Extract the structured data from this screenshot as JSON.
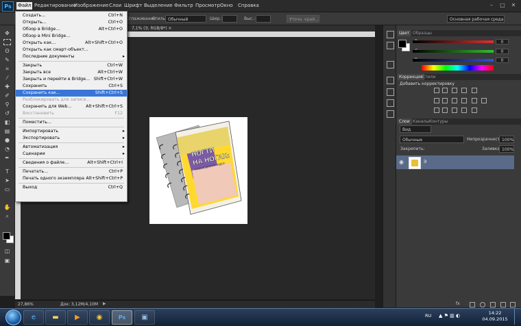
{
  "app": {
    "logo": "Ps",
    "menus": [
      "Файл",
      "Редактирование",
      "Изображение",
      "Слои",
      "Шрифт",
      "Выделение",
      "Фильтр",
      "Просмотр",
      "Окно",
      "Справка"
    ],
    "active_menu": "Файл",
    "window_controls": [
      "–",
      "□",
      "✕"
    ]
  },
  "options_bar": {
    "style_label": "Стиль:",
    "style_value": "Обычный",
    "width_label": "Шир.:",
    "height_label": "Выс.:",
    "refine_button": "Уточн. край...",
    "workspace": "Основная рабочая среда",
    "smoothing_label": "Сглаживание"
  },
  "document": {
    "tab_title": "7,1% (Э, RGB/8*) ×",
    "zoom": "27,86%",
    "doc_size": "Док: 3,12M/4,10M"
  },
  "file_menu": {
    "items": [
      {
        "label": "Создать...",
        "shortcut": "Ctrl+N"
      },
      {
        "label": "Открыть...",
        "shortcut": "Ctrl+O"
      },
      {
        "label": "Обзор в Bridge...",
        "shortcut": "Alt+Ctrl+O"
      },
      {
        "label": "Обзор в Mini Bridge...",
        "shortcut": ""
      },
      {
        "label": "Открыть как...",
        "shortcut": "Alt+Shift+Ctrl+O"
      },
      {
        "label": "Открыть как смарт-объект...",
        "shortcut": ""
      },
      {
        "label": "Последние документы",
        "shortcut": "",
        "submenu": true
      },
      {
        "sep": true
      },
      {
        "label": "Закрыть",
        "shortcut": "Ctrl+W"
      },
      {
        "label": "Закрыть все",
        "shortcut": "Alt+Ctrl+W"
      },
      {
        "label": "Закрыть и перейти в Bridge...",
        "shortcut": "Shift+Ctrl+W"
      },
      {
        "label": "Сохранить",
        "shortcut": "Ctrl+S"
      },
      {
        "label": "Сохранить как...",
        "shortcut": "Shift+Ctrl+S",
        "highlight": true
      },
      {
        "label": "Разблокировать для записи...",
        "shortcut": "",
        "disabled": true
      },
      {
        "label": "Сохранить для Web...",
        "shortcut": "Alt+Shift+Ctrl+S"
      },
      {
        "label": "Восстановить",
        "shortcut": "F12",
        "disabled": true
      },
      {
        "sep": true
      },
      {
        "label": "Поместить...",
        "shortcut": ""
      },
      {
        "sep": true
      },
      {
        "label": "Импортировать",
        "shortcut": "",
        "submenu": true
      },
      {
        "label": "Экспортировать",
        "shortcut": "",
        "submenu": true
      },
      {
        "sep": true
      },
      {
        "label": "Автоматизация",
        "shortcut": "",
        "submenu": true
      },
      {
        "label": "Сценарии",
        "shortcut": "",
        "submenu": true
      },
      {
        "sep": true
      },
      {
        "label": "Сведения о файле...",
        "shortcut": "Alt+Shift+Ctrl+I"
      },
      {
        "sep": true
      },
      {
        "label": "Печатать...",
        "shortcut": "Ctrl+P"
      },
      {
        "label": "Печать одного экземпляра",
        "shortcut": "Alt+Shift+Ctrl+P"
      },
      {
        "sep": true
      },
      {
        "label": "Выход",
        "shortcut": "Ctrl+Q"
      }
    ]
  },
  "color_panel": {
    "tabs": [
      "Цвет",
      "Образцы"
    ],
    "channels": [
      {
        "label": "R",
        "value": "0",
        "color": "#e03030"
      },
      {
        "label": "G",
        "value": "0",
        "color": "#30c030"
      },
      {
        "label": "B",
        "value": "0",
        "color": "#3050e0"
      }
    ]
  },
  "adjustments_panel": {
    "tabs": [
      "Коррекция",
      "Стили"
    ],
    "heading": "Добавить корректировку"
  },
  "layers_panel": {
    "tabs": [
      "Слои",
      "Каналы",
      "Контуры"
    ],
    "kind_label": "Вид",
    "blend_mode": "Обычные",
    "opacity_label": "Непрозрачность:",
    "opacity_value": "100%",
    "lock_label": "Закрепить:",
    "fill_label": "Заливка:",
    "fill_value": "100%",
    "layer_name": "Э",
    "footer_icons": "fx"
  },
  "book": {
    "title_line1": "НОГТИ",
    "title_line2": "НА НОГАХ:",
    "subtitle": "НОВЫЕ ДИЗАЙН-ИДЕИ"
  },
  "taskbar": {
    "lang": "RU",
    "time": "14:22",
    "date": "04.09.2015"
  }
}
